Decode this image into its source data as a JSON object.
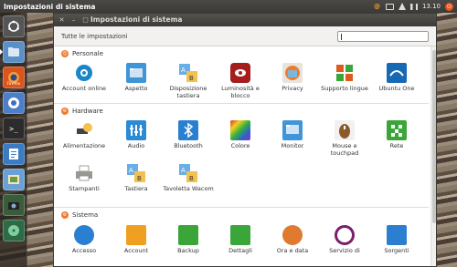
{
  "top_panel": {
    "title": "Impostazioni di sistema",
    "clock": "13.10"
  },
  "launcher": {
    "items": [
      {
        "name": "dash",
        "color": "#7a7a7a"
      },
      {
        "name": "files",
        "color": "#5b8fc7"
      },
      {
        "name": "firefox",
        "label": "Firefox",
        "color": "#d9541e"
      },
      {
        "name": "chromium",
        "color": "#4d7fc8"
      },
      {
        "name": "terminal",
        "color": "#2c2c2c"
      },
      {
        "name": "writer",
        "color": "#3b7bc4"
      },
      {
        "name": "images",
        "color": "#6aa0d6"
      },
      {
        "name": "shotwell",
        "color": "#3a5c3a"
      },
      {
        "name": "media",
        "color": "#2f6a47"
      }
    ]
  },
  "window": {
    "title": "Impostazioni di sistema",
    "all_settings": "Tutte le impostazioni",
    "search_placeholder": ""
  },
  "sections": [
    {
      "title": "Personale",
      "items": [
        {
          "label": "Account online",
          "icon": "online-accounts-icon",
          "color": "#1a86c8"
        },
        {
          "label": "Aspetto",
          "icon": "appearance-icon",
          "color": "#3f95d8"
        },
        {
          "label": "Disposizione tastiera",
          "icon": "keyboard-layout-icon",
          "color": "#5b9bd5"
        },
        {
          "label": "Luminosità e blocco",
          "icon": "brightness-lock-icon",
          "color": "#a51d1d"
        },
        {
          "label": "Privacy",
          "icon": "privacy-icon",
          "color": "#7ab8d8"
        },
        {
          "label": "Supporto lingue",
          "icon": "language-support-icon",
          "color": "#e05a1e"
        },
        {
          "label": "Ubuntu One",
          "icon": "ubuntu-one-icon",
          "color": "#1769b5"
        }
      ]
    },
    {
      "title": "Hardware",
      "items": [
        {
          "label": "Alimentazione",
          "icon": "power-icon",
          "color": "#3a3a3a"
        },
        {
          "label": "Audio",
          "icon": "sound-icon",
          "color": "#2a8ad4"
        },
        {
          "label": "Bluetooth",
          "icon": "bluetooth-icon",
          "color": "#2a7fd0"
        },
        {
          "label": "Colore",
          "icon": "color-icon",
          "color": "#c44a2a"
        },
        {
          "label": "Monitor",
          "icon": "display-icon",
          "color": "#3f95d8"
        },
        {
          "label": "Mouse e touchpad",
          "icon": "mouse-icon",
          "color": "#8a5a2a"
        },
        {
          "label": "Rete",
          "icon": "network-icon",
          "color": "#3aa63a"
        },
        {
          "label": "Stampanti",
          "icon": "printer-icon",
          "color": "#9a9690"
        },
        {
          "label": "Tastiera",
          "icon": "keyboard-icon",
          "color": "#5b9bd5"
        },
        {
          "label": "Tavoletta Wacom",
          "icon": "wacom-icon",
          "color": "#5b9bd5"
        }
      ]
    },
    {
      "title": "Sistema",
      "items": [
        {
          "label": "Accesso",
          "icon": "accessibility-icon",
          "color": "#2a7fd0"
        },
        {
          "label": "Account",
          "icon": "user-accounts-icon",
          "color": "#f0a020"
        },
        {
          "label": "Backup",
          "icon": "backup-icon",
          "color": "#3aa63a"
        },
        {
          "label": "Dettagli",
          "icon": "details-icon",
          "color": "#3aa63a"
        },
        {
          "label": "Ora e data",
          "icon": "time-date-icon",
          "color": "#e07a30"
        },
        {
          "label": "Servizio di",
          "icon": "service-icon",
          "color": "#7a1f6a"
        },
        {
          "label": "Sorgenti",
          "icon": "software-sources-icon",
          "color": "#2a7fd0"
        }
      ]
    }
  ]
}
